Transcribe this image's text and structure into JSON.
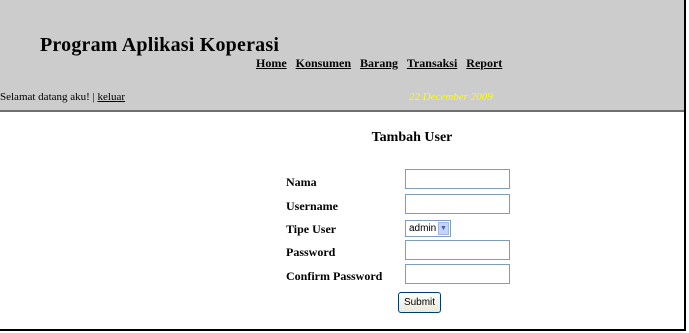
{
  "header": {
    "app_title": "Program Aplikasi Koperasi",
    "nav": [
      {
        "label": "Home"
      },
      {
        "label": "Konsumen"
      },
      {
        "label": "Barang"
      },
      {
        "label": "Transaksi"
      },
      {
        "label": "Report"
      }
    ],
    "welcome_text": "Selamat datang aku! | ",
    "logout_label": "keluar",
    "date": "22 December 2009",
    "colors": {
      "header_bg": "#cccccc",
      "date_text": "#ffff00"
    }
  },
  "form": {
    "title": "Tambah User",
    "fields": {
      "nama": {
        "label": "Nama",
        "value": ""
      },
      "username": {
        "label": "Username",
        "value": ""
      },
      "tipe_user": {
        "label": "Tipe User",
        "value": "admin"
      },
      "password": {
        "label": "Password",
        "value": ""
      },
      "confirm_password": {
        "label": "Confirm Password",
        "value": ""
      }
    },
    "submit_label": "Submit"
  }
}
